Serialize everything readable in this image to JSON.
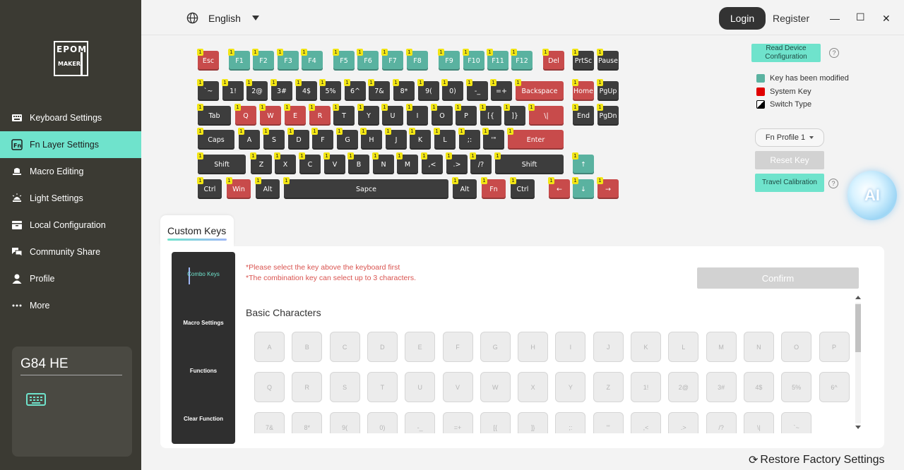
{
  "sidebar": {
    "logo": {
      "line1": "EPOM",
      "line2": "MAKER"
    },
    "items": [
      {
        "label": "Keyboard Settings",
        "icon": "keyboard-icon",
        "active": false
      },
      {
        "label": "Fn Layer Settings",
        "icon": "fn-icon",
        "active": true
      },
      {
        "label": "Macro Editing",
        "icon": "macro-icon",
        "active": false
      },
      {
        "label": "Light Settings",
        "icon": "light-icon",
        "active": false
      },
      {
        "label": "Local Configuration",
        "icon": "local-config-icon",
        "active": false
      },
      {
        "label": "Community Share",
        "icon": "community-icon",
        "active": false
      },
      {
        "label": "Profile",
        "icon": "user-icon",
        "active": false
      },
      {
        "label": "More",
        "icon": "more-icon",
        "active": false
      }
    ],
    "device": {
      "name": "G84 HE",
      "icon": "keyboard-icon"
    }
  },
  "topbar": {
    "language": "English",
    "login": "Login",
    "register": "Register",
    "minimize": "—",
    "maximize": "☐",
    "close": "✕"
  },
  "keyboard": {
    "badge": "1",
    "colors": {
      "normal": "#3d3d3d",
      "modified": "#5ab2a0",
      "system": "#c84b4b",
      "badge": "#f2e514"
    },
    "keys": [
      {
        "label": "Esc",
        "type": "sys"
      },
      {
        "label": "F1",
        "type": "mod"
      },
      {
        "label": "F2",
        "type": "mod"
      },
      {
        "label": "F3",
        "type": "mod"
      },
      {
        "label": "F4",
        "type": "mod"
      },
      {
        "label": "F5",
        "type": "mod"
      },
      {
        "label": "F6",
        "type": "mod"
      },
      {
        "label": "F7",
        "type": "mod"
      },
      {
        "label": "F8",
        "type": "mod"
      },
      {
        "label": "F9",
        "type": "mod"
      },
      {
        "label": "F10",
        "type": "mod"
      },
      {
        "label": "F11",
        "type": "mod"
      },
      {
        "label": "F12",
        "type": "mod"
      },
      {
        "label": "Del",
        "type": "sys"
      },
      {
        "label": "PrtSc",
        "type": "normal"
      },
      {
        "label": "Pause",
        "type": "normal"
      },
      {
        "label": "`~",
        "type": "normal"
      },
      {
        "label": "1!",
        "type": "normal"
      },
      {
        "label": "2@",
        "type": "normal"
      },
      {
        "label": "3#",
        "type": "normal"
      },
      {
        "label": "4$",
        "type": "normal"
      },
      {
        "label": "5%",
        "type": "normal"
      },
      {
        "label": "6^",
        "type": "normal"
      },
      {
        "label": "7&",
        "type": "normal"
      },
      {
        "label": "8*",
        "type": "normal"
      },
      {
        "label": "9(",
        "type": "normal"
      },
      {
        "label": "0)",
        "type": "normal"
      },
      {
        "label": "-_",
        "type": "normal"
      },
      {
        "label": "=+",
        "type": "normal"
      },
      {
        "label": "Backspace",
        "type": "sys"
      },
      {
        "label": "Home",
        "type": "sys"
      },
      {
        "label": "PgUp",
        "type": "normal"
      },
      {
        "label": "Tab",
        "type": "normal"
      },
      {
        "label": "Q",
        "type": "sys"
      },
      {
        "label": "W",
        "type": "sys"
      },
      {
        "label": "E",
        "type": "sys"
      },
      {
        "label": "R",
        "type": "sys"
      },
      {
        "label": "T",
        "type": "normal"
      },
      {
        "label": "Y",
        "type": "normal"
      },
      {
        "label": "U",
        "type": "normal"
      },
      {
        "label": "I",
        "type": "normal"
      },
      {
        "label": "O",
        "type": "normal"
      },
      {
        "label": "P",
        "type": "normal"
      },
      {
        "label": "[{",
        "type": "normal"
      },
      {
        "label": "]}",
        "type": "normal"
      },
      {
        "label": "\\|",
        "type": "sys"
      },
      {
        "label": "End",
        "type": "normal"
      },
      {
        "label": "PgDn",
        "type": "normal"
      },
      {
        "label": "Caps",
        "type": "normal"
      },
      {
        "label": "A",
        "type": "normal"
      },
      {
        "label": "S",
        "type": "normal"
      },
      {
        "label": "D",
        "type": "normal"
      },
      {
        "label": "F",
        "type": "normal"
      },
      {
        "label": "G",
        "type": "normal"
      },
      {
        "label": "H",
        "type": "normal"
      },
      {
        "label": "J",
        "type": "normal"
      },
      {
        "label": "K",
        "type": "normal"
      },
      {
        "label": "L",
        "type": "normal"
      },
      {
        "label": ";:",
        "type": "normal"
      },
      {
        "label": "'\"",
        "type": "normal"
      },
      {
        "label": "Enter",
        "type": "sys"
      },
      {
        "label": "Shift",
        "type": "normal"
      },
      {
        "label": "Z",
        "type": "normal"
      },
      {
        "label": "X",
        "type": "normal"
      },
      {
        "label": "C",
        "type": "normal"
      },
      {
        "label": "V",
        "type": "normal"
      },
      {
        "label": "B",
        "type": "normal"
      },
      {
        "label": "N",
        "type": "normal"
      },
      {
        "label": "M",
        "type": "normal"
      },
      {
        "label": ",<",
        "type": "normal"
      },
      {
        "label": ".>",
        "type": "normal"
      },
      {
        "label": "/?",
        "type": "normal"
      },
      {
        "label": "Shift",
        "type": "normal"
      },
      {
        "label": "↑",
        "type": "mod"
      },
      {
        "label": "Ctrl",
        "type": "normal"
      },
      {
        "label": "Win",
        "type": "sys"
      },
      {
        "label": "Alt",
        "type": "normal"
      },
      {
        "label": "Sapce",
        "type": "normal"
      },
      {
        "label": "Alt",
        "type": "normal"
      },
      {
        "label": "Fn",
        "type": "sys"
      },
      {
        "label": "Ctrl",
        "type": "normal"
      },
      {
        "label": "←",
        "type": "sys"
      },
      {
        "label": "↓",
        "type": "mod"
      },
      {
        "label": "→",
        "type": "sys"
      }
    ]
  },
  "right_panel": {
    "read_config": "Read Device Configuration",
    "legend": [
      {
        "label": "Key has been modified",
        "color": "#5ab2a0"
      },
      {
        "label": "System Key",
        "color": "#e00000"
      },
      {
        "label": "Switch Type",
        "color": "#000000"
      }
    ],
    "profile": "Fn Profile 1",
    "reset_key": "Reset Key",
    "travel_calibration": "Travel Calibration",
    "ai_label": "AI",
    "help": "?"
  },
  "custom_keys": {
    "tab_label": "Custom Keys",
    "side_items": [
      "Combo Keys",
      "Macro Settings",
      "Functions",
      "Clear Function"
    ],
    "hint1": "*Please select the key above the keyboard first",
    "hint2": "*The combination key can select up to 3 characters.",
    "confirm": "Confirm",
    "section_title": "Basic Characters",
    "characters": [
      "A",
      "B",
      "C",
      "D",
      "E",
      "F",
      "G",
      "H",
      "I",
      "J",
      "K",
      "L",
      "M",
      "N",
      "O",
      "P",
      "Q",
      "R",
      "S",
      "T",
      "U",
      "V",
      "W",
      "X",
      "Y",
      "Z",
      "1!",
      "2@",
      "3#",
      "4$",
      "5%",
      "6^",
      "7&",
      "8*",
      "9(",
      "0)",
      "-_",
      "=+",
      "[{",
      "]}",
      ";:",
      "'\"",
      ",<",
      ".>",
      "/?",
      "\\|",
      "`~"
    ]
  },
  "footer": {
    "restore": "Restore Factory Settings"
  }
}
